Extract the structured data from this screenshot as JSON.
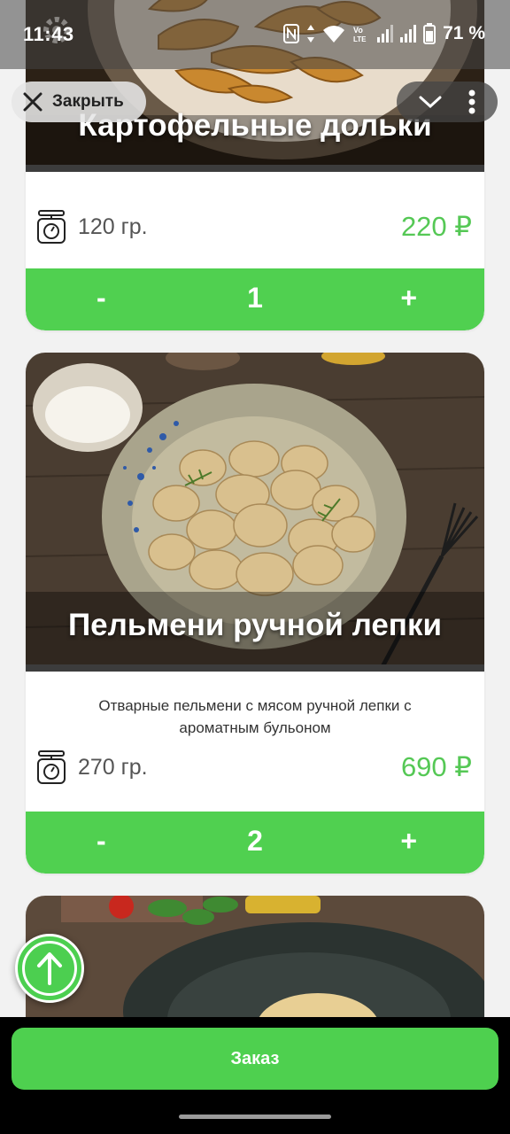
{
  "status_bar": {
    "time": "11:43",
    "battery": "71 %",
    "icons": [
      "settings-icon",
      "nfc-icon",
      "data-arrows-icon",
      "wifi-icon",
      "volte-icon",
      "signal-icon",
      "signal-icon",
      "battery-icon"
    ]
  },
  "overlay": {
    "close_label": "Закрыть"
  },
  "cards": [
    {
      "title": "Картофельные дольки",
      "weight": "120 гр.",
      "price": "220 ₽",
      "qty_minus": "-",
      "quantity": "1",
      "qty_plus": "+"
    },
    {
      "title": "Пельмени ручной лепки",
      "description": "Отварные пельмени с мясом ручной лепки с ароматным бульоном",
      "weight": "270 гр.",
      "price": "690 ₽",
      "qty_minus": "-",
      "quantity": "2",
      "qty_plus": "+"
    }
  ],
  "footer": {
    "order_label": "Заказ"
  },
  "colors": {
    "accent": "#50d050",
    "price": "#55c855"
  }
}
